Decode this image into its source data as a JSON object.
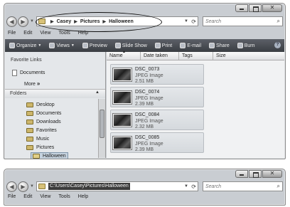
{
  "window1": {
    "breadcrumbs": [
      "Casey",
      "Pictures",
      "Halloween"
    ],
    "search_placeholder": "Search",
    "menu": [
      "File",
      "Edit",
      "View",
      "Tools",
      "Help"
    ],
    "toolbar": [
      "Organize",
      "Views",
      "Preview",
      "Slide Show",
      "Print",
      "E-mail",
      "Share",
      "Burn"
    ],
    "help_glyph": "?",
    "favorite_links_title": "Favorite Links",
    "favorite_links": [
      "Documents"
    ],
    "more_label": "More",
    "more_glyph": "»",
    "folders_title": "Folders",
    "tree": [
      "Desktop",
      "Documents",
      "Downloads",
      "Favorites",
      "Music",
      "Pictures",
      "Halloween"
    ],
    "columns": [
      "Name",
      "Date taken",
      "Tags",
      "Size"
    ],
    "files": [
      {
        "name": "DSC_0073",
        "type": "JPEG Image",
        "size": "2.51 MB"
      },
      {
        "name": "DSC_0074",
        "type": "JPEG Image",
        "size": "2.39 MB"
      },
      {
        "name": "DSC_0084",
        "type": "JPEG Image",
        "size": "2.32 MB"
      },
      {
        "name": "DSC_0085",
        "type": "JPEG Image",
        "size": "2.39 MB"
      }
    ]
  },
  "window2": {
    "path": "C:\\Users\\Casey\\Pictures\\Halloween",
    "search_placeholder": "Search",
    "menu": [
      "File",
      "Edit",
      "View",
      "Tools",
      "Help"
    ]
  },
  "colors": {
    "toolbar": "#3a3d42",
    "window_frame": "#c9cdd2",
    "content_bg": "#f1f2f3",
    "selection": "#c5d2de"
  }
}
